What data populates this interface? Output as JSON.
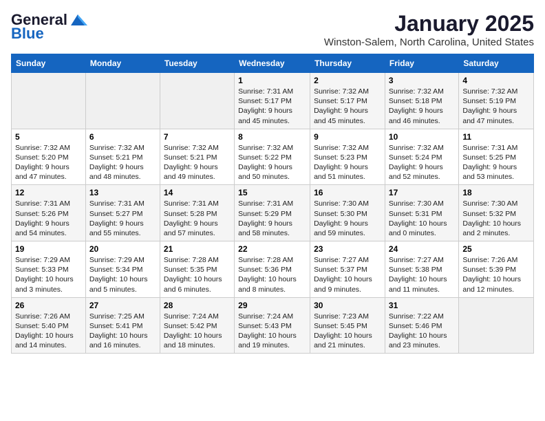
{
  "header": {
    "logo_general": "General",
    "logo_blue": "Blue",
    "month": "January 2025",
    "location": "Winston-Salem, North Carolina, United States"
  },
  "weekdays": [
    "Sunday",
    "Monday",
    "Tuesday",
    "Wednesday",
    "Thursday",
    "Friday",
    "Saturday"
  ],
  "weeks": [
    [
      {
        "day": "",
        "content": ""
      },
      {
        "day": "",
        "content": ""
      },
      {
        "day": "",
        "content": ""
      },
      {
        "day": "1",
        "content": "Sunrise: 7:31 AM\nSunset: 5:17 PM\nDaylight: 9 hours\nand 45 minutes."
      },
      {
        "day": "2",
        "content": "Sunrise: 7:32 AM\nSunset: 5:17 PM\nDaylight: 9 hours\nand 45 minutes."
      },
      {
        "day": "3",
        "content": "Sunrise: 7:32 AM\nSunset: 5:18 PM\nDaylight: 9 hours\nand 46 minutes."
      },
      {
        "day": "4",
        "content": "Sunrise: 7:32 AM\nSunset: 5:19 PM\nDaylight: 9 hours\nand 47 minutes."
      }
    ],
    [
      {
        "day": "5",
        "content": "Sunrise: 7:32 AM\nSunset: 5:20 PM\nDaylight: 9 hours\nand 47 minutes."
      },
      {
        "day": "6",
        "content": "Sunrise: 7:32 AM\nSunset: 5:21 PM\nDaylight: 9 hours\nand 48 minutes."
      },
      {
        "day": "7",
        "content": "Sunrise: 7:32 AM\nSunset: 5:21 PM\nDaylight: 9 hours\nand 49 minutes."
      },
      {
        "day": "8",
        "content": "Sunrise: 7:32 AM\nSunset: 5:22 PM\nDaylight: 9 hours\nand 50 minutes."
      },
      {
        "day": "9",
        "content": "Sunrise: 7:32 AM\nSunset: 5:23 PM\nDaylight: 9 hours\nand 51 minutes."
      },
      {
        "day": "10",
        "content": "Sunrise: 7:32 AM\nSunset: 5:24 PM\nDaylight: 9 hours\nand 52 minutes."
      },
      {
        "day": "11",
        "content": "Sunrise: 7:31 AM\nSunset: 5:25 PM\nDaylight: 9 hours\nand 53 minutes."
      }
    ],
    [
      {
        "day": "12",
        "content": "Sunrise: 7:31 AM\nSunset: 5:26 PM\nDaylight: 9 hours\nand 54 minutes."
      },
      {
        "day": "13",
        "content": "Sunrise: 7:31 AM\nSunset: 5:27 PM\nDaylight: 9 hours\nand 55 minutes."
      },
      {
        "day": "14",
        "content": "Sunrise: 7:31 AM\nSunset: 5:28 PM\nDaylight: 9 hours\nand 57 minutes."
      },
      {
        "day": "15",
        "content": "Sunrise: 7:31 AM\nSunset: 5:29 PM\nDaylight: 9 hours\nand 58 minutes."
      },
      {
        "day": "16",
        "content": "Sunrise: 7:30 AM\nSunset: 5:30 PM\nDaylight: 9 hours\nand 59 minutes."
      },
      {
        "day": "17",
        "content": "Sunrise: 7:30 AM\nSunset: 5:31 PM\nDaylight: 10 hours\nand 0 minutes."
      },
      {
        "day": "18",
        "content": "Sunrise: 7:30 AM\nSunset: 5:32 PM\nDaylight: 10 hours\nand 2 minutes."
      }
    ],
    [
      {
        "day": "19",
        "content": "Sunrise: 7:29 AM\nSunset: 5:33 PM\nDaylight: 10 hours\nand 3 minutes."
      },
      {
        "day": "20",
        "content": "Sunrise: 7:29 AM\nSunset: 5:34 PM\nDaylight: 10 hours\nand 5 minutes."
      },
      {
        "day": "21",
        "content": "Sunrise: 7:28 AM\nSunset: 5:35 PM\nDaylight: 10 hours\nand 6 minutes."
      },
      {
        "day": "22",
        "content": "Sunrise: 7:28 AM\nSunset: 5:36 PM\nDaylight: 10 hours\nand 8 minutes."
      },
      {
        "day": "23",
        "content": "Sunrise: 7:27 AM\nSunset: 5:37 PM\nDaylight: 10 hours\nand 9 minutes."
      },
      {
        "day": "24",
        "content": "Sunrise: 7:27 AM\nSunset: 5:38 PM\nDaylight: 10 hours\nand 11 minutes."
      },
      {
        "day": "25",
        "content": "Sunrise: 7:26 AM\nSunset: 5:39 PM\nDaylight: 10 hours\nand 12 minutes."
      }
    ],
    [
      {
        "day": "26",
        "content": "Sunrise: 7:26 AM\nSunset: 5:40 PM\nDaylight: 10 hours\nand 14 minutes."
      },
      {
        "day": "27",
        "content": "Sunrise: 7:25 AM\nSunset: 5:41 PM\nDaylight: 10 hours\nand 16 minutes."
      },
      {
        "day": "28",
        "content": "Sunrise: 7:24 AM\nSunset: 5:42 PM\nDaylight: 10 hours\nand 18 minutes."
      },
      {
        "day": "29",
        "content": "Sunrise: 7:24 AM\nSunset: 5:43 PM\nDaylight: 10 hours\nand 19 minutes."
      },
      {
        "day": "30",
        "content": "Sunrise: 7:23 AM\nSunset: 5:45 PM\nDaylight: 10 hours\nand 21 minutes."
      },
      {
        "day": "31",
        "content": "Sunrise: 7:22 AM\nSunset: 5:46 PM\nDaylight: 10 hours\nand 23 minutes."
      },
      {
        "day": "",
        "content": ""
      }
    ]
  ]
}
